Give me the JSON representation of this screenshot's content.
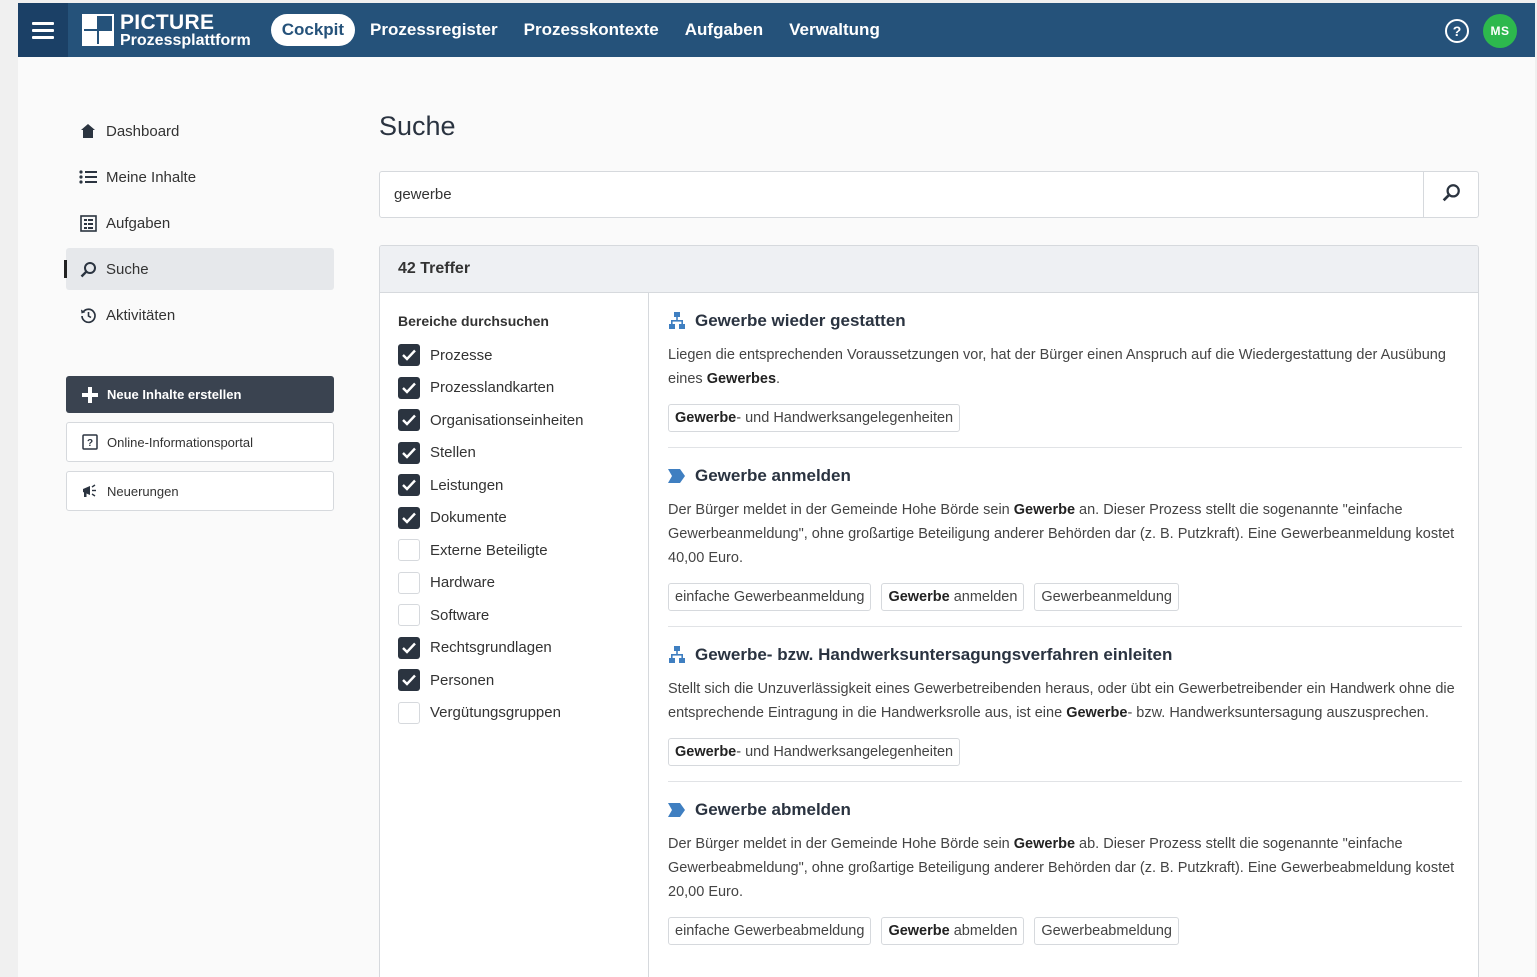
{
  "app": {
    "logo_line1": "PICTURE",
    "logo_line2": "Prozessplattform",
    "nav": [
      "Cockpit",
      "Prozessregister",
      "Prozesskontexte",
      "Aufgaben",
      "Verwaltung"
    ],
    "active_nav": "Cockpit",
    "help_icon": "question-circle-icon",
    "user_initials": "MS",
    "colors": {
      "header": "#25527a",
      "avatar": "#2db84d",
      "dark_button": "#3a4350"
    }
  },
  "sidebar": {
    "items": [
      {
        "label": "Dashboard",
        "icon": "home-icon"
      },
      {
        "label": "Meine Inhalte",
        "icon": "list-icon"
      },
      {
        "label": "Aufgaben",
        "icon": "tasks-icon"
      },
      {
        "label": "Suche",
        "icon": "search-icon",
        "active": true
      },
      {
        "label": "Aktivitäten",
        "icon": "history-icon"
      }
    ],
    "create_button": "Neue Inhalte erstellen",
    "portal_button": "Online-Informationsportal",
    "news_button": "Neuerungen"
  },
  "main": {
    "title": "Suche",
    "search_value": "gewerbe",
    "hits_count": "42 Treffer",
    "filters_title": "Bereiche durchsuchen",
    "filters": [
      {
        "label": "Prozesse",
        "checked": true
      },
      {
        "label": "Prozesslandkarten",
        "checked": true
      },
      {
        "label": "Organisationseinheiten",
        "checked": true
      },
      {
        "label": "Stellen",
        "checked": true
      },
      {
        "label": "Leistungen",
        "checked": true
      },
      {
        "label": "Dokumente",
        "checked": true
      },
      {
        "label": "Externe Beteiligte",
        "checked": false
      },
      {
        "label": "Hardware",
        "checked": false
      },
      {
        "label": "Software",
        "checked": false
      },
      {
        "label": "Rechtsgrundlagen",
        "checked": true
      },
      {
        "label": "Personen",
        "checked": true
      },
      {
        "label": "Vergütungsgruppen",
        "checked": false
      }
    ],
    "results": [
      {
        "icon": "process-map-icon",
        "title": "Gewerbe wieder gestatten",
        "desc": [
          "Liegen die entsprechenden Voraussetzungen vor, hat der Bürger einen Anspruch auf die Wiedergestattung der Ausübung eines ",
          "Gewerbes",
          "."
        ],
        "tags": [
          [
            "Gewerbe",
            "- und Handwerksangelegenheiten"
          ]
        ]
      },
      {
        "icon": "process-icon",
        "title": "Gewerbe anmelden",
        "desc": [
          "Der Bürger meldet in der Gemeinde Hohe Börde sein ",
          "Gewerbe",
          " an. Dieser Prozess stellt die sogenannte \"einfache Gewerbeanmeldung\", ohne großartige Beteiligung anderer Behörden dar (z. B. Putzkraft). Eine Gewerbeanmeldung kostet 40,00 Euro."
        ],
        "tags": [
          [
            "",
            "einfache Gewerbeanmeldung"
          ],
          [
            "Gewerbe",
            " anmelden"
          ],
          [
            "",
            "Gewerbeanmeldung"
          ]
        ]
      },
      {
        "icon": "process-map-icon",
        "title": "Gewerbe- bzw. Handwerksuntersagungsverfahren einleiten",
        "desc": [
          "Stellt sich die Unzuverlässigkeit eines Gewerbetreibenden heraus, oder übt ein Gewerbetreibender ein Handwerk ohne die entsprechende Eintragung in die Handwerksrolle aus, ist eine ",
          "Gewerbe",
          "- bzw. Handwerksuntersagung auszusprechen."
        ],
        "tags": [
          [
            "Gewerbe",
            "- und Handwerksangelegenheiten"
          ]
        ]
      },
      {
        "icon": "process-icon",
        "title": "Gewerbe abmelden",
        "desc": [
          "Der Bürger meldet in der Gemeinde Hohe Börde sein ",
          "Gewerbe",
          " ab. Dieser Prozess stellt die sogenannte \"einfache Gewerbeabmeldung\", ohne großartige Beteiligung anderer Behörden dar (z. B. Putzkraft). Eine Gewerbeabmeldung kostet 20,00 Euro."
        ],
        "tags": [
          [
            "",
            "einfache Gewerbeabmeldung"
          ],
          [
            "Gewerbe",
            " abmelden"
          ],
          [
            "",
            "Gewerbeabmeldung"
          ]
        ]
      }
    ]
  }
}
